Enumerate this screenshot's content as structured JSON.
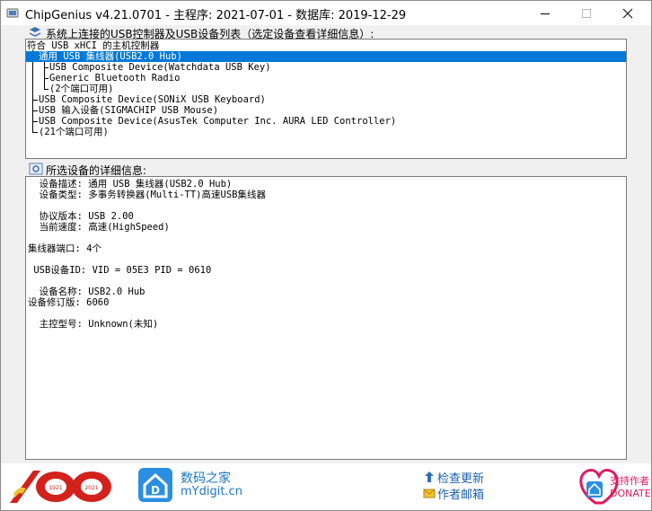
{
  "window": {
    "title": "ChipGenius v4.21.0701 - 主程序: 2021-07-01 - 数据库: 2019-12-29"
  },
  "device_list": {
    "label": "系统上连接的USB控制器及USB设备列表（选定设备查看详细信息）:",
    "items": [
      {
        "text": "符合 USB xHCI 的主机控制器"
      },
      {
        "text": "通用 USB 集线器(USB2.0 Hub)",
        "selected": true
      },
      {
        "text": "USB Composite Device(Watchdata USB Key)"
      },
      {
        "text": "Generic Bluetooth Radio"
      },
      {
        "text": "(2个端口可用)"
      },
      {
        "text": "USB Composite Device(SONiX USB Keyboard)"
      },
      {
        "text": "USB 输入设备(SIGMACHIP USB Mouse)"
      },
      {
        "text": "USB Composite Device(AsusTek Computer Inc. AURA LED Controller)"
      },
      {
        "text": "(21个端口可用)"
      }
    ]
  },
  "details": {
    "label": "所选设备的详细信息:",
    "lines": [
      "  设备描述: 通用 USB 集线器(USB2.0 Hub)",
      "  设备类型: 多事务转换器(Multi-TT)高速USB集线器",
      "",
      "  协议版本: USB 2.00",
      "  当前速度: 高速(HighSpeed)",
      "",
      "集线器端口: 4个",
      "",
      " USB设备ID: VID = 05E3 PID = 0610",
      "",
      "  设备名称: USB2.0 Hub",
      "设备修订版: 6060",
      "",
      "  主控型号: Unknown(未知)"
    ]
  },
  "footer": {
    "site_name": "数码之家",
    "site_url": "mYdigit.cn",
    "check_update": "检查更新",
    "author_mail": "作者邮箱",
    "donate_cn": "支持作者",
    "donate_en": "DONATE",
    "badge_year_left": "1921",
    "badge_year_right": "2021"
  },
  "colors": {
    "selection": "#0078d7",
    "link": "#1a5fb4",
    "badge_red": "#d3211b",
    "donate_pink": "#e01b5b"
  }
}
